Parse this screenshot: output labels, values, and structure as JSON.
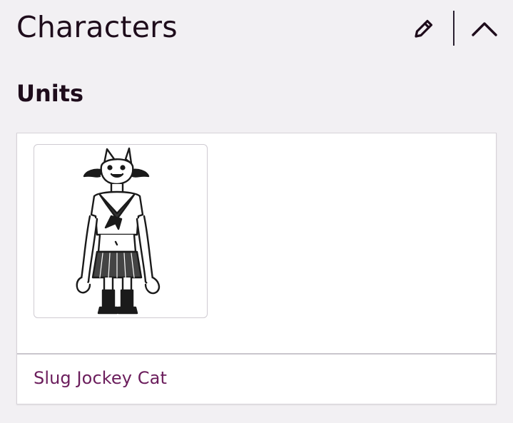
{
  "header": {
    "title": "Characters",
    "edit_icon": "pencil-icon",
    "collapse_icon": "chevron-up-icon"
  },
  "units": {
    "heading": "Units",
    "items": [
      {
        "name": "Slug Jockey Cat",
        "image_alt": "Slug Jockey Cat"
      }
    ]
  },
  "colors": {
    "background": "#f2f0f3",
    "text": "#1e0c1b",
    "link": "#6b1d5c",
    "card": "#ffffff",
    "border": "#d7d3d9"
  }
}
